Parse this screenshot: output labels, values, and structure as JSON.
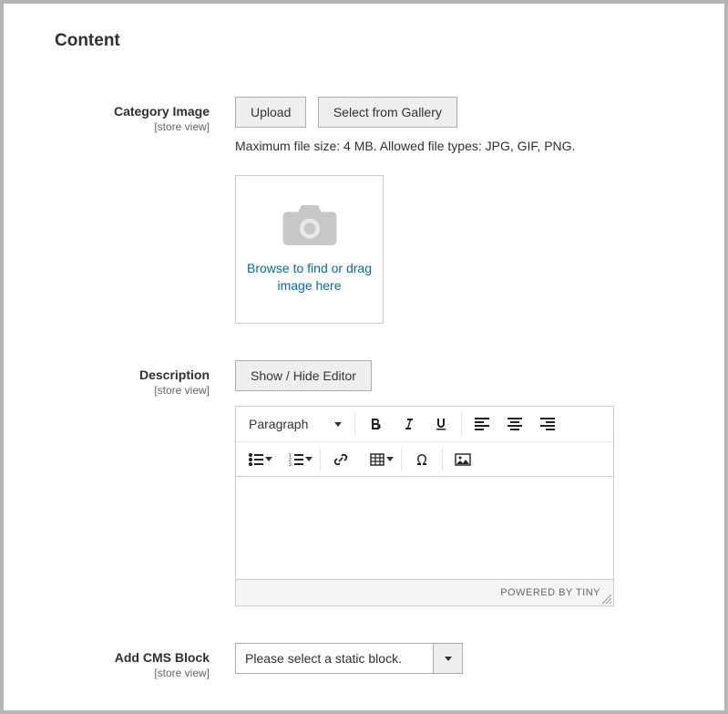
{
  "section": {
    "title": "Content"
  },
  "category_image": {
    "label": "Category Image",
    "scope": "[store view]",
    "upload_btn": "Upload",
    "gallery_btn": "Select from Gallery",
    "helper": "Maximum file size: 4 MB. Allowed file types: JPG, GIF, PNG.",
    "placeholder_text": "Browse to find or drag image here"
  },
  "description": {
    "label": "Description",
    "scope": "[store view]",
    "toggle_btn": "Show / Hide Editor",
    "format_selected": "Paragraph",
    "footer": "POWERED BY TINY",
    "value": ""
  },
  "cms_block": {
    "label": "Add CMS Block",
    "scope": "[store view]",
    "selected": "Please select a static block."
  }
}
